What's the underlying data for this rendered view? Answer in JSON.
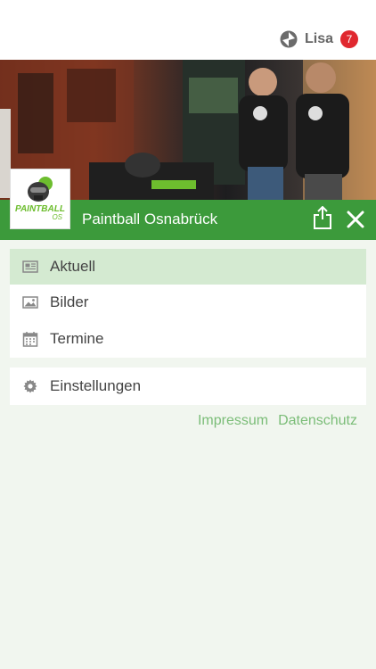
{
  "header": {
    "user_name": "Lisa",
    "notification_count": "7",
    "user_icon": "dice-icon"
  },
  "organization": {
    "title": "Paintball Osnabrück",
    "logo_text_top": "PAINTBALL",
    "logo_text_bottom": "OS"
  },
  "actions": {
    "share_icon": "share-icon",
    "close_icon": "close-icon"
  },
  "menu": {
    "items": [
      {
        "label": "Aktuell",
        "icon": "newspaper-icon",
        "active": true
      },
      {
        "label": "Bilder",
        "icon": "image-icon",
        "active": false
      },
      {
        "label": "Termine",
        "icon": "calendar-icon",
        "active": false
      }
    ]
  },
  "settings": {
    "label": "Einstellungen",
    "icon": "gear-icon"
  },
  "footer": {
    "impressum": "Impressum",
    "datenschutz": "Datenschutz"
  },
  "colors": {
    "brand_green": "#3c9a3b",
    "active_row": "#d4ead1",
    "page_background": "#f1f6ef",
    "link_green": "#7bbd78",
    "badge_red": "#e0282f"
  }
}
